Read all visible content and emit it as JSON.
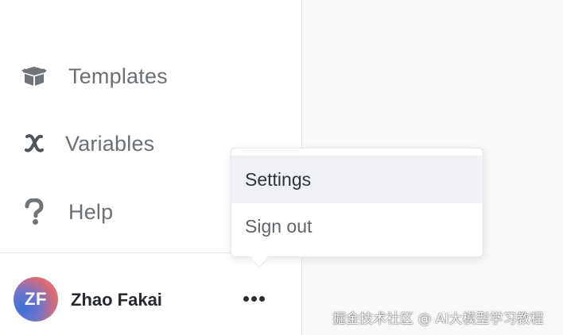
{
  "sidebar": {
    "items": [
      {
        "label": "Templates",
        "icon": "box-icon"
      },
      {
        "label": "Variables",
        "icon": "variable-x-icon"
      },
      {
        "label": "Help",
        "icon": "question-icon"
      }
    ],
    "user": {
      "initials": "ZF",
      "name": "Zhao Fakai",
      "more_icon": "ellipsis-icon"
    }
  },
  "menu": {
    "items": [
      {
        "label": "Settings",
        "highlighted": true
      },
      {
        "label": "Sign out",
        "highlighted": false
      }
    ]
  },
  "watermark": "掘金技术社区 @ AI大模型学习教程",
  "colors": {
    "sidebar_bg": "#ffffff",
    "main_bg": "#f8f9fb",
    "text_muted": "#6b7074",
    "menu_highlight": "#eff1f4"
  }
}
